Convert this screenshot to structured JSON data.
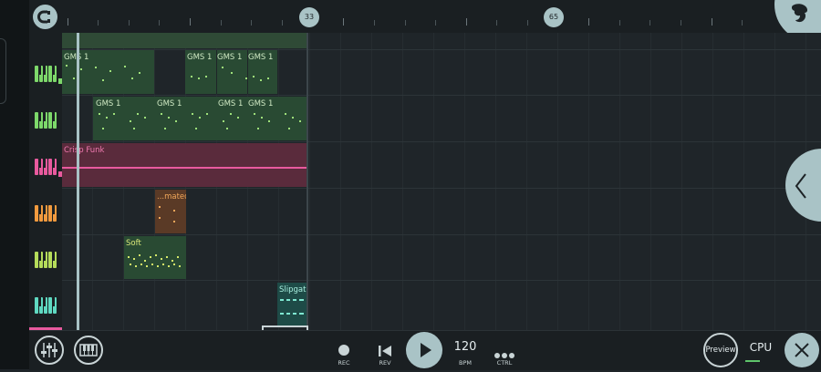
{
  "ruler": {
    "marker_33": "33",
    "marker_65": "65"
  },
  "tracks": [
    {
      "color": "#7dd86a"
    },
    {
      "color": "#7dd86a"
    },
    {
      "color": "#e85a9e"
    },
    {
      "color": "#f29a3e"
    },
    {
      "color": "#b5dc5a"
    },
    {
      "color": "#5fd9c1"
    }
  ],
  "clips": {
    "row1_a": "GMS 1",
    "row1_b": "GMS 1",
    "row1_c": "GMS 1",
    "row1_d": "GMS 1",
    "row2_a": "GMS 1",
    "row2_b": "GMS 1",
    "row2_c": "GMS 1",
    "row2_d": "GMS 1",
    "row3": "Crisp Funk",
    "row4": "...mated",
    "row5": "Soft",
    "row6": "Slipgate"
  },
  "transport": {
    "rec_label": "REC",
    "rev_label": "REV",
    "bpm_value": "120",
    "bpm_label": "BPM",
    "ctrl_label": "CTRL",
    "preview_label": "Preview",
    "cpu_label": "CPU"
  },
  "colors": {
    "accent": "#a9c3c6",
    "clip_green": "#294a33",
    "clip_pink": "#5a2b3c"
  }
}
